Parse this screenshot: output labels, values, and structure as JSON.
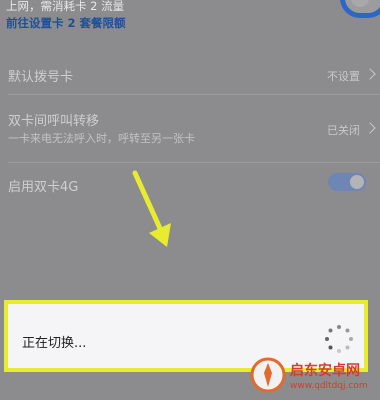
{
  "top": {
    "description": "上网，需消耗卡 2 流量",
    "link": "前往设置卡 2 套餐限额"
  },
  "settings": {
    "default_dial": {
      "label": "默认拨号卡",
      "value": "不设置"
    },
    "call_forward": {
      "label": "双卡间呼叫转移",
      "sub": "一卡来电无法呼入时，呼转至另一张卡",
      "value": "已关闭"
    },
    "dual_4g": {
      "label": "启用双卡4G",
      "enabled": true
    }
  },
  "dialog": {
    "message": "正在切换..."
  },
  "watermark": {
    "title": "启东安卓网",
    "url": "www.qdltdqj.com"
  }
}
